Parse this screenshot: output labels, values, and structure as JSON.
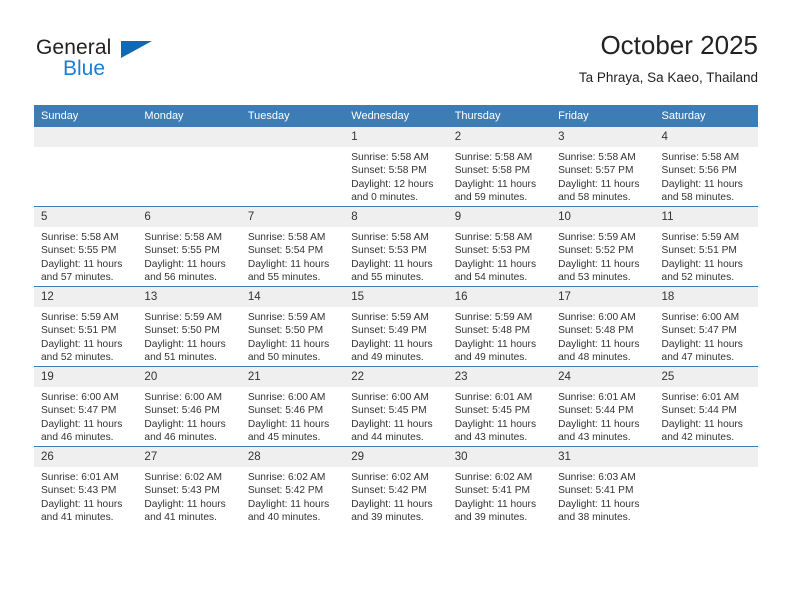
{
  "brand": {
    "name_top": "General",
    "name_bottom": "Blue",
    "triangle_color": "#1268b3",
    "blue_color": "#1a7fd4"
  },
  "header": {
    "title": "October 2025",
    "subtitle": "Ta Phraya, Sa Kaeo, Thailand"
  },
  "theme": {
    "header_bg": "#3e7cb6",
    "daynum_bg": "#efefef",
    "text": "#333333"
  },
  "calendar": {
    "weekday_headers": [
      "Sunday",
      "Monday",
      "Tuesday",
      "Wednesday",
      "Thursday",
      "Friday",
      "Saturday"
    ],
    "weeks": [
      [
        {
          "day": "",
          "empty": true
        },
        {
          "day": "",
          "empty": true
        },
        {
          "day": "",
          "empty": true
        },
        {
          "day": "1",
          "sunrise": "Sunrise: 5:58 AM",
          "sunset": "Sunset: 5:58 PM",
          "daylight_1": "Daylight: 12 hours",
          "daylight_2": "and 0 minutes."
        },
        {
          "day": "2",
          "sunrise": "Sunrise: 5:58 AM",
          "sunset": "Sunset: 5:58 PM",
          "daylight_1": "Daylight: 11 hours",
          "daylight_2": "and 59 minutes."
        },
        {
          "day": "3",
          "sunrise": "Sunrise: 5:58 AM",
          "sunset": "Sunset: 5:57 PM",
          "daylight_1": "Daylight: 11 hours",
          "daylight_2": "and 58 minutes."
        },
        {
          "day": "4",
          "sunrise": "Sunrise: 5:58 AM",
          "sunset": "Sunset: 5:56 PM",
          "daylight_1": "Daylight: 11 hours",
          "daylight_2": "and 58 minutes."
        }
      ],
      [
        {
          "day": "5",
          "sunrise": "Sunrise: 5:58 AM",
          "sunset": "Sunset: 5:55 PM",
          "daylight_1": "Daylight: 11 hours",
          "daylight_2": "and 57 minutes."
        },
        {
          "day": "6",
          "sunrise": "Sunrise: 5:58 AM",
          "sunset": "Sunset: 5:55 PM",
          "daylight_1": "Daylight: 11 hours",
          "daylight_2": "and 56 minutes."
        },
        {
          "day": "7",
          "sunrise": "Sunrise: 5:58 AM",
          "sunset": "Sunset: 5:54 PM",
          "daylight_1": "Daylight: 11 hours",
          "daylight_2": "and 55 minutes."
        },
        {
          "day": "8",
          "sunrise": "Sunrise: 5:58 AM",
          "sunset": "Sunset: 5:53 PM",
          "daylight_1": "Daylight: 11 hours",
          "daylight_2": "and 55 minutes."
        },
        {
          "day": "9",
          "sunrise": "Sunrise: 5:58 AM",
          "sunset": "Sunset: 5:53 PM",
          "daylight_1": "Daylight: 11 hours",
          "daylight_2": "and 54 minutes."
        },
        {
          "day": "10",
          "sunrise": "Sunrise: 5:59 AM",
          "sunset": "Sunset: 5:52 PM",
          "daylight_1": "Daylight: 11 hours",
          "daylight_2": "and 53 minutes."
        },
        {
          "day": "11",
          "sunrise": "Sunrise: 5:59 AM",
          "sunset": "Sunset: 5:51 PM",
          "daylight_1": "Daylight: 11 hours",
          "daylight_2": "and 52 minutes."
        }
      ],
      [
        {
          "day": "12",
          "sunrise": "Sunrise: 5:59 AM",
          "sunset": "Sunset: 5:51 PM",
          "daylight_1": "Daylight: 11 hours",
          "daylight_2": "and 52 minutes."
        },
        {
          "day": "13",
          "sunrise": "Sunrise: 5:59 AM",
          "sunset": "Sunset: 5:50 PM",
          "daylight_1": "Daylight: 11 hours",
          "daylight_2": "and 51 minutes."
        },
        {
          "day": "14",
          "sunrise": "Sunrise: 5:59 AM",
          "sunset": "Sunset: 5:50 PM",
          "daylight_1": "Daylight: 11 hours",
          "daylight_2": "and 50 minutes."
        },
        {
          "day": "15",
          "sunrise": "Sunrise: 5:59 AM",
          "sunset": "Sunset: 5:49 PM",
          "daylight_1": "Daylight: 11 hours",
          "daylight_2": "and 49 minutes."
        },
        {
          "day": "16",
          "sunrise": "Sunrise: 5:59 AM",
          "sunset": "Sunset: 5:48 PM",
          "daylight_1": "Daylight: 11 hours",
          "daylight_2": "and 49 minutes."
        },
        {
          "day": "17",
          "sunrise": "Sunrise: 6:00 AM",
          "sunset": "Sunset: 5:48 PM",
          "daylight_1": "Daylight: 11 hours",
          "daylight_2": "and 48 minutes."
        },
        {
          "day": "18",
          "sunrise": "Sunrise: 6:00 AM",
          "sunset": "Sunset: 5:47 PM",
          "daylight_1": "Daylight: 11 hours",
          "daylight_2": "and 47 minutes."
        }
      ],
      [
        {
          "day": "19",
          "sunrise": "Sunrise: 6:00 AM",
          "sunset": "Sunset: 5:47 PM",
          "daylight_1": "Daylight: 11 hours",
          "daylight_2": "and 46 minutes."
        },
        {
          "day": "20",
          "sunrise": "Sunrise: 6:00 AM",
          "sunset": "Sunset: 5:46 PM",
          "daylight_1": "Daylight: 11 hours",
          "daylight_2": "and 46 minutes."
        },
        {
          "day": "21",
          "sunrise": "Sunrise: 6:00 AM",
          "sunset": "Sunset: 5:46 PM",
          "daylight_1": "Daylight: 11 hours",
          "daylight_2": "and 45 minutes."
        },
        {
          "day": "22",
          "sunrise": "Sunrise: 6:00 AM",
          "sunset": "Sunset: 5:45 PM",
          "daylight_1": "Daylight: 11 hours",
          "daylight_2": "and 44 minutes."
        },
        {
          "day": "23",
          "sunrise": "Sunrise: 6:01 AM",
          "sunset": "Sunset: 5:45 PM",
          "daylight_1": "Daylight: 11 hours",
          "daylight_2": "and 43 minutes."
        },
        {
          "day": "24",
          "sunrise": "Sunrise: 6:01 AM",
          "sunset": "Sunset: 5:44 PM",
          "daylight_1": "Daylight: 11 hours",
          "daylight_2": "and 43 minutes."
        },
        {
          "day": "25",
          "sunrise": "Sunrise: 6:01 AM",
          "sunset": "Sunset: 5:44 PM",
          "daylight_1": "Daylight: 11 hours",
          "daylight_2": "and 42 minutes."
        }
      ],
      [
        {
          "day": "26",
          "sunrise": "Sunrise: 6:01 AM",
          "sunset": "Sunset: 5:43 PM",
          "daylight_1": "Daylight: 11 hours",
          "daylight_2": "and 41 minutes."
        },
        {
          "day": "27",
          "sunrise": "Sunrise: 6:02 AM",
          "sunset": "Sunset: 5:43 PM",
          "daylight_1": "Daylight: 11 hours",
          "daylight_2": "and 41 minutes."
        },
        {
          "day": "28",
          "sunrise": "Sunrise: 6:02 AM",
          "sunset": "Sunset: 5:42 PM",
          "daylight_1": "Daylight: 11 hours",
          "daylight_2": "and 40 minutes."
        },
        {
          "day": "29",
          "sunrise": "Sunrise: 6:02 AM",
          "sunset": "Sunset: 5:42 PM",
          "daylight_1": "Daylight: 11 hours",
          "daylight_2": "and 39 minutes."
        },
        {
          "day": "30",
          "sunrise": "Sunrise: 6:02 AM",
          "sunset": "Sunset: 5:41 PM",
          "daylight_1": "Daylight: 11 hours",
          "daylight_2": "and 39 minutes."
        },
        {
          "day": "31",
          "sunrise": "Sunrise: 6:03 AM",
          "sunset": "Sunset: 5:41 PM",
          "daylight_1": "Daylight: 11 hours",
          "daylight_2": "and 38 minutes."
        },
        {
          "day": "",
          "empty": true
        }
      ]
    ]
  }
}
